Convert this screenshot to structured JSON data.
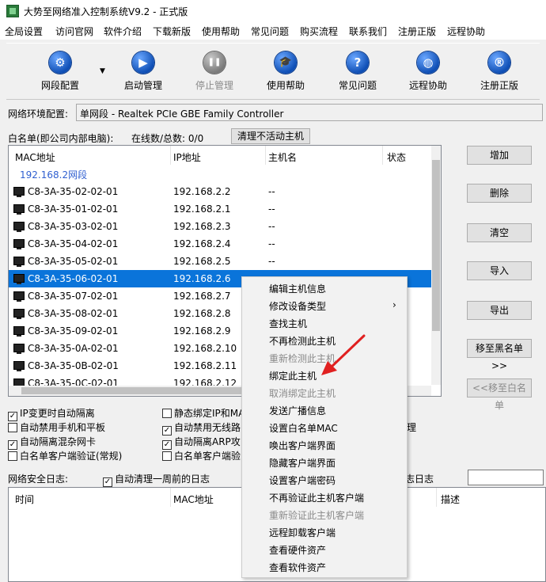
{
  "window": {
    "title": "大势至网络准入控制系统V9.2 - 正式版"
  },
  "menu": [
    "全局设置",
    "访问官网",
    "软件介绍",
    "下载新版",
    "使用帮助",
    "常见问题",
    "购买流程",
    "联系我们",
    "注册正版",
    "远程协助"
  ],
  "toolbar": [
    {
      "label": "网段配置",
      "icon": "gear-icon",
      "glyph": "⚙",
      "enabled": true
    },
    {
      "label": "启动管理",
      "icon": "play-icon",
      "glyph": "▶",
      "enabled": true
    },
    {
      "label": "停止管理",
      "icon": "pause-icon",
      "glyph": "❚❚",
      "enabled": false
    },
    {
      "label": "使用帮助",
      "icon": "graduation-cap-icon",
      "glyph": "🎓",
      "enabled": true
    },
    {
      "label": "常见问题",
      "icon": "question-icon",
      "glyph": "?",
      "enabled": true
    },
    {
      "label": "远程协助",
      "icon": "globe-icon",
      "glyph": "◍",
      "enabled": true
    },
    {
      "label": "注册正版",
      "icon": "registered-icon",
      "glyph": "®",
      "enabled": true
    }
  ],
  "env": {
    "label": "网络环境配置:",
    "value": "单网段 - Realtek PCIe GBE Family Controller"
  },
  "whitelist": {
    "label": "白名单(即公司内部电脑):",
    "online": "在线数/总数: 0/0",
    "clear_btn": "清理不活动主机",
    "columns": [
      "MAC地址",
      "IP地址",
      "主机名",
      "状态"
    ],
    "group": "192.168.2网段",
    "rows": [
      {
        "mac": "C8-3A-35-02-02-01",
        "ip": "192.168.2.2",
        "host": "--"
      },
      {
        "mac": "C8-3A-35-01-02-01",
        "ip": "192.168.2.1",
        "host": "--"
      },
      {
        "mac": "C8-3A-35-03-02-01",
        "ip": "192.168.2.3",
        "host": "--"
      },
      {
        "mac": "C8-3A-35-04-02-01",
        "ip": "192.168.2.4",
        "host": "--"
      },
      {
        "mac": "C8-3A-35-05-02-01",
        "ip": "192.168.2.5",
        "host": "--"
      },
      {
        "mac": "C8-3A-35-06-02-01",
        "ip": "192.168.2.6",
        "host": "",
        "selected": true
      },
      {
        "mac": "C8-3A-35-07-02-01",
        "ip": "192.168.2.7",
        "host": ""
      },
      {
        "mac": "C8-3A-35-08-02-01",
        "ip": "192.168.2.8",
        "host": ""
      },
      {
        "mac": "C8-3A-35-09-02-01",
        "ip": "192.168.2.9",
        "host": ""
      },
      {
        "mac": "C8-3A-35-0A-02-01",
        "ip": "192.168.2.10",
        "host": ""
      },
      {
        "mac": "C8-3A-35-0B-02-01",
        "ip": "192.168.2.11",
        "host": ""
      },
      {
        "mac": "C8-3A-35-0C-02-01",
        "ip": "192.168.2.12",
        "host": ""
      }
    ]
  },
  "side_buttons": [
    {
      "label": "增加",
      "enabled": true
    },
    {
      "label": "删除",
      "enabled": true
    },
    {
      "label": "清空",
      "enabled": true
    },
    {
      "label": "导入",
      "enabled": true
    },
    {
      "label": "导出",
      "enabled": true
    },
    {
      "label": "移至黑名单>>",
      "enabled": true
    },
    {
      "label": "<<移至白名单",
      "enabled": false
    }
  ],
  "options_left": [
    {
      "label": "IP变更时自动隔离",
      "checked": true
    },
    {
      "label": "自动禁用手机和平板",
      "checked": false
    },
    {
      "label": "自动隔离混杂网卡",
      "checked": true
    },
    {
      "label": "白名单客户端验证(常规)",
      "checked": false
    }
  ],
  "options_mid": [
    {
      "label": "静态绑定IP和MA",
      "checked": false
    },
    {
      "label": "自动禁用无线路",
      "checked": true
    },
    {
      "label": "自动隔离ARP攻",
      "checked": true
    },
    {
      "label": "白名单客户端验",
      "checked": false
    }
  ],
  "options_right_partial": "理",
  "log": {
    "label": "网络安全日志:",
    "auto_clean": "自动清理一周前的日志",
    "auto_clean_checked": true,
    "partial_label": "志日志",
    "columns": [
      "时间",
      "MAC地址",
      "描述"
    ]
  },
  "context_menu": [
    {
      "label": "编辑主机信息",
      "enabled": true
    },
    {
      "label": "修改设备类型",
      "enabled": true,
      "submenu": true
    },
    {
      "label": "查找主机",
      "enabled": true
    },
    {
      "label": "不再检测此主机",
      "enabled": true
    },
    {
      "label": "重新检测此主机",
      "enabled": false
    },
    {
      "label": "绑定此主机",
      "enabled": true
    },
    {
      "label": "取消绑定此主机",
      "enabled": false
    },
    {
      "label": "发送广播信息",
      "enabled": true
    },
    {
      "label": "设置白名单MAC",
      "enabled": true
    },
    {
      "label": "唤出客户端界面",
      "enabled": true
    },
    {
      "label": "隐藏客户端界面",
      "enabled": true
    },
    {
      "label": "设置客户端密码",
      "enabled": true
    },
    {
      "label": "不再验证此主机客户端",
      "enabled": true
    },
    {
      "label": "重新验证此主机客户端",
      "enabled": false
    },
    {
      "label": "远程卸载客户端",
      "enabled": true
    },
    {
      "label": "查看硬件资产",
      "enabled": true
    },
    {
      "label": "查看软件资产",
      "enabled": true
    }
  ],
  "colors": {
    "selection": "#0a74da",
    "annotation_arrow": "#e02020",
    "group_text": "#2f5fd0"
  }
}
